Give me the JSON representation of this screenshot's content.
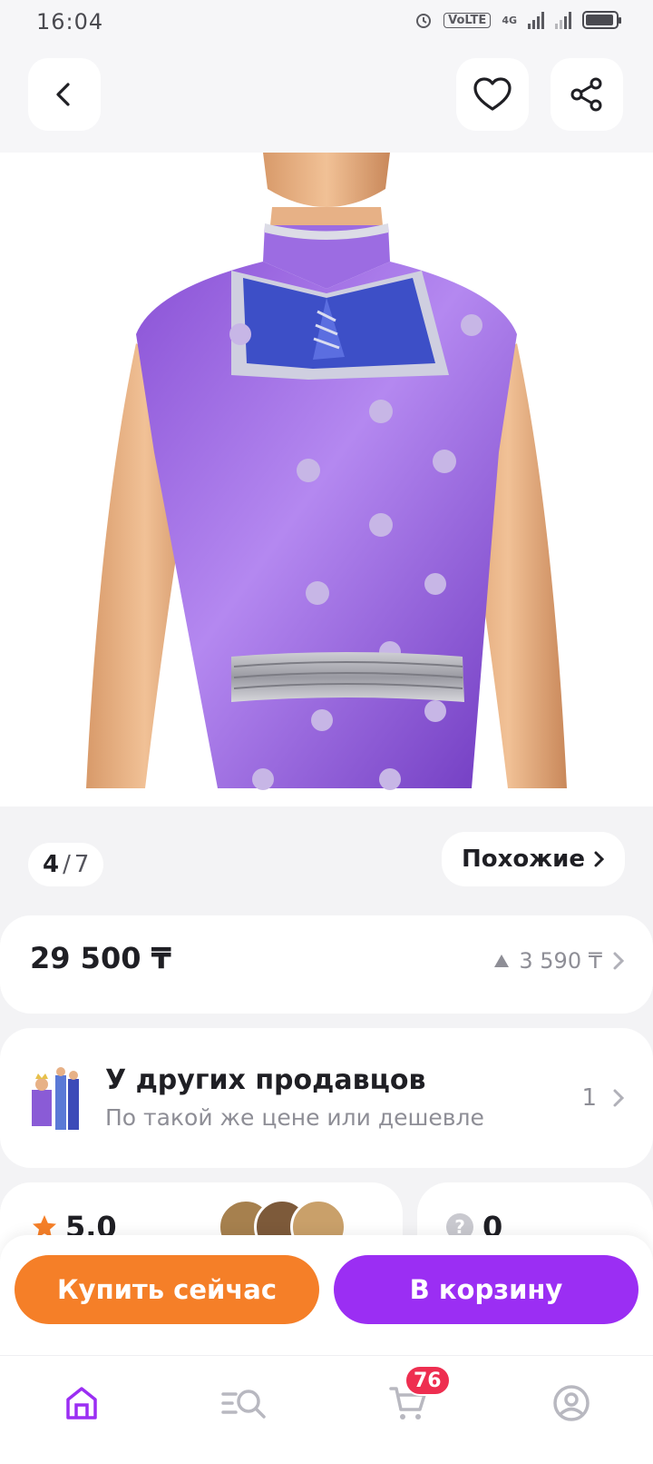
{
  "status_bar": {
    "time": "16:04",
    "volte": "VoLTE",
    "network": "4G"
  },
  "gallery": {
    "current": "4",
    "separator": "/",
    "total": "7",
    "similar_label": "Похожие"
  },
  "price": {
    "main": "29 500 ₸",
    "bonus": "3 590 ₸"
  },
  "sellers": {
    "title": "У других продавцов",
    "subtitle": "По такой же цене или дешевле",
    "count": "1"
  },
  "rating": {
    "value": "5.0"
  },
  "questions": {
    "count": "0"
  },
  "actions": {
    "buy_now": "Купить сейчас",
    "add_to_cart": "В корзину"
  },
  "nav": {
    "cart_badge": "76"
  },
  "colors": {
    "accent": "#9b2ef3",
    "buy": "#f57f28",
    "badge": "#ee2e50",
    "star": "#f57f28"
  }
}
